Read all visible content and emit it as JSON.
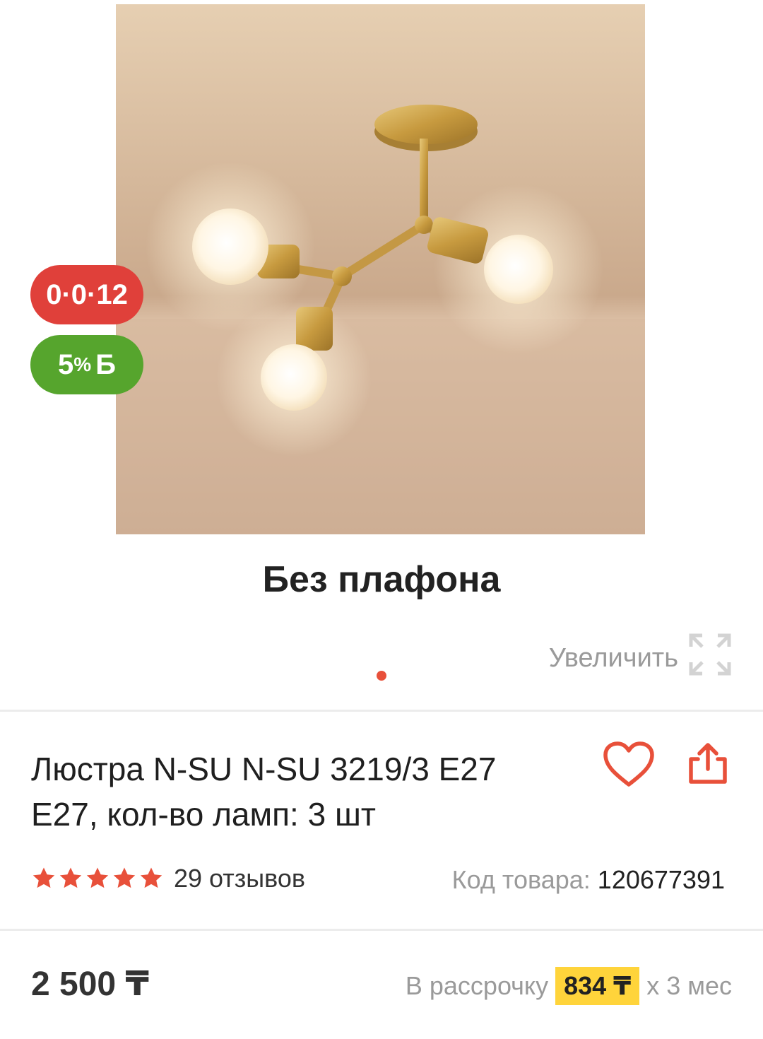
{
  "badges": {
    "installment": "0·0·12",
    "bonus_percent": "5",
    "bonus_symbol": "%",
    "bonus_currency": "Б"
  },
  "image": {
    "caption": "Без плафона",
    "zoom_label": "Увеличить",
    "zoom_icon": "expand-icon"
  },
  "product": {
    "title": "Люстра N-SU N-SU 3219/3 E27 E27, кол-во ламп: 3 шт",
    "rating_stars": 5,
    "reviews": "29 отзывов",
    "code_label": "Код товара:",
    "code_value": "120677391"
  },
  "pricing": {
    "price": "2 500 ₸",
    "installment_prefix": "В рассрочку",
    "installment_amount": "834 ₸",
    "installment_suffix": "x 3 мес"
  },
  "colors": {
    "accent": "#e8503a",
    "bonus": "#56a52d",
    "highlight": "#ffd43b"
  }
}
